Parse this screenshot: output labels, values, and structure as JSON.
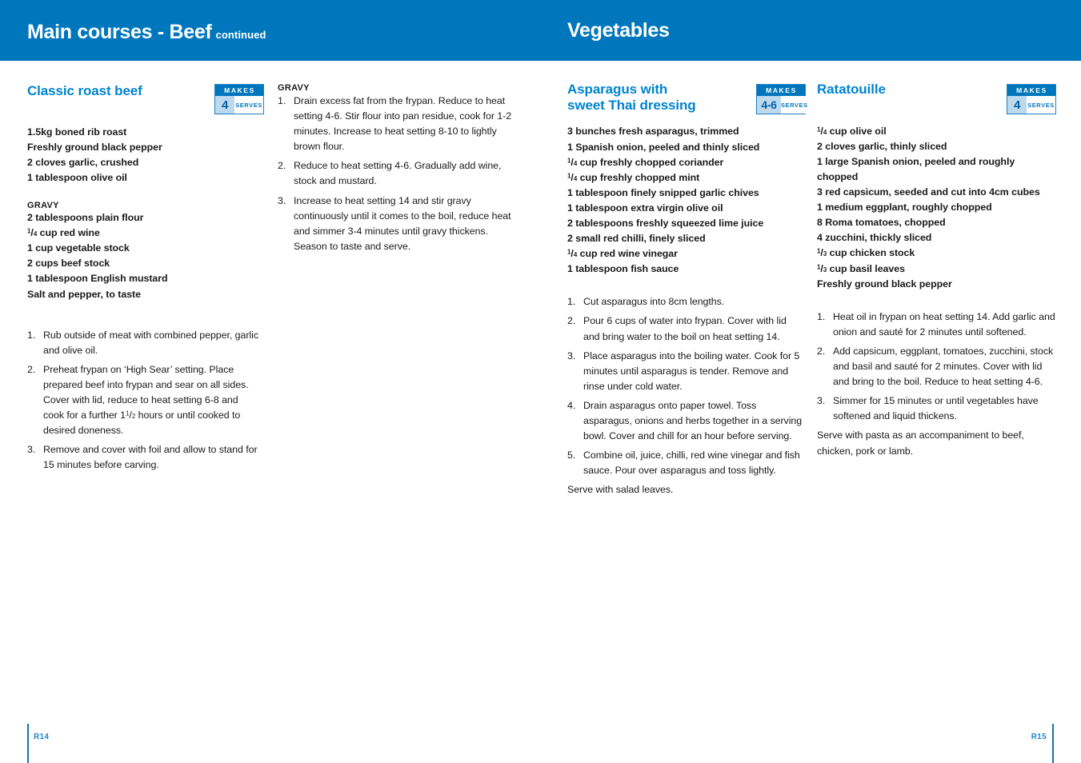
{
  "header": {
    "left_title": "Main courses - Beef",
    "left_continued": "continued",
    "right_title": "Vegetables"
  },
  "badges": {
    "makes_label": "MAKES",
    "serves_label": "SERVES",
    "classic_roast_beef": "4",
    "asparagus": "4-6",
    "ratatouille": "4"
  },
  "recipes": {
    "classic_roast_beef": {
      "title": "Classic roast beef",
      "ingredients": [
        "1.5kg boned rib roast",
        "Freshly ground black pepper",
        "2 cloves garlic, crushed",
        "1 tablespoon olive oil"
      ],
      "gravy_label": "GRAVY",
      "gravy_ingredients": [
        "2 tablespoons plain flour",
        "FRAC_1_4 cup red wine",
        "1 cup vegetable stock",
        "2 cups beef stock",
        "1 tablespoon English mustard",
        "Salt and pepper, to taste"
      ],
      "method": [
        {
          "num": "1.",
          "text": "Rub outside of meat with combined pepper, garlic and olive oil."
        },
        {
          "num": "2.",
          "text": "Preheat frypan on ‘High Sear’ setting. Place prepared beef into frypan and sear on all sides. Cover with lid, reduce to heat setting 6-8 and cook for a further 1FRAC_1_2 hours or until cooked to desired doneness."
        },
        {
          "num": "3.",
          "text": "Remove and cover with foil and allow to stand for 15 minutes before carving."
        }
      ],
      "gravy_method_label": "GRAVY",
      "gravy_method": [
        {
          "num": "1.",
          "text": "Drain excess fat from the frypan. Reduce to heat setting 4-6. Stir flour into pan residue, cook for 1-2 minutes. Increase to heat setting 8-10 to lightly brown flour."
        },
        {
          "num": "2.",
          "text": "Reduce to heat setting 4-6. Gradually add wine, stock and mustard."
        },
        {
          "num": "3.",
          "text": "Increase to heat setting 14 and stir gravy continuously until it comes to the boil, reduce heat and simmer 3-4 minutes until gravy thickens. Season to taste and serve."
        }
      ]
    },
    "asparagus": {
      "title_line1": "Asparagus with",
      "title_line2": "sweet Thai dressing",
      "ingredients": [
        "3 bunches fresh asparagus, trimmed",
        "1 Spanish onion, peeled and thinly sliced",
        "FRAC_1_4 cup freshly chopped coriander",
        "FRAC_1_4 cup freshly chopped mint",
        "1 tablespoon finely snipped garlic chives",
        "1 tablespoon extra virgin olive oil",
        "2 tablespoons freshly squeezed lime juice",
        "2 small red chilli, finely sliced",
        "FRAC_1_4 cup red wine vinegar",
        "1 tablespoon fish sauce"
      ],
      "method": [
        {
          "num": "1.",
          "text": "Cut asparagus into 8cm lengths."
        },
        {
          "num": "2.",
          "text": "Pour 6 cups of water into frypan. Cover with lid and bring water to the boil on heat setting 14."
        },
        {
          "num": "3.",
          "text": "Place asparagus into the boiling water. Cook for 5 minutes until asparagus is tender. Remove and rinse under cold water."
        },
        {
          "num": "4.",
          "text": "Drain asparagus onto paper towel. Toss asparagus, onions and herbs together in a serving bowl. Cover and chill for an hour before serving."
        },
        {
          "num": "5.",
          "text": "Combine oil, juice, chilli, red wine vinegar and fish sauce. Pour over asparagus and toss lightly."
        }
      ],
      "note": "Serve with salad leaves."
    },
    "ratatouille": {
      "title": "Ratatouille",
      "ingredients": [
        "FRAC_1_4 cup olive oil",
        "2 cloves garlic, thinly sliced",
        "1 large Spanish onion, peeled and roughly chopped",
        "3 red capsicum, seeded and cut into 4cm cubes",
        "1 medium eggplant, roughly chopped",
        "8 Roma tomatoes, chopped",
        "4 zucchini, thickly sliced",
        "FRAC_1_3 cup chicken stock",
        "FRAC_1_3 cup basil leaves",
        "Freshly ground black pepper"
      ],
      "method": [
        {
          "num": "1.",
          "text": "Heat oil in frypan on heat setting 14. Add garlic and onion and sauté for 2 minutes until softened."
        },
        {
          "num": "2.",
          "text": "Add capsicum, eggplant, tomatoes, zucchini, stock and basil and sauté for 2 minutes. Cover with lid and bring to the boil. Reduce to heat setting 4-6."
        },
        {
          "num": "3.",
          "text": "Simmer for 15 minutes or until vegetables have softened and liquid thickens."
        }
      ],
      "note": "Serve with pasta as an accompaniment to beef, chicken, pork or lamb."
    }
  },
  "footer": {
    "left_page": "R14",
    "right_page": "R15"
  },
  "colors": {
    "header_blue": "#0077bd",
    "title_blue": "#0084cf",
    "badge_fill": "#bcd9ee",
    "rule_blue": "#1173b0"
  }
}
